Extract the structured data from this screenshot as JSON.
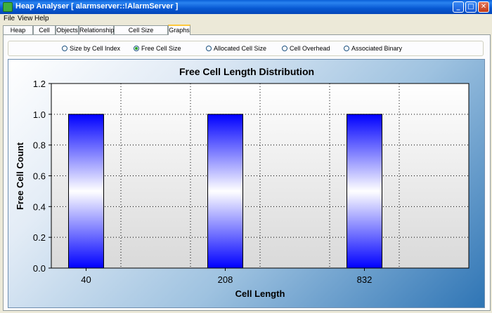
{
  "window": {
    "title": "Heap Analyser [ alarmserver::!AlarmServer ]",
    "controls": {
      "minimize": "_",
      "maximize": "□",
      "close": "✕"
    }
  },
  "menu": {
    "items": [
      "File",
      "View",
      "Help"
    ]
  },
  "tabs": [
    {
      "label": "Heap View",
      "active": false
    },
    {
      "label": "Cell List",
      "active": false
    },
    {
      "label": "Objects",
      "active": false
    },
    {
      "label": "Relationships",
      "active": false
    },
    {
      "label": "Cell Size Distributions",
      "active": false
    },
    {
      "label": "Graphs",
      "active": true
    }
  ],
  "graph_options": [
    {
      "label": "Size by Cell Index",
      "selected": false
    },
    {
      "label": "Free Cell Size",
      "selected": true
    },
    {
      "label": "Allocated Cell Size",
      "selected": false
    },
    {
      "label": "Cell Overhead",
      "selected": false
    },
    {
      "label": "Associated Binary",
      "selected": false
    }
  ],
  "chart_data": {
    "type": "bar",
    "title": "Free Cell Length Distribution",
    "xlabel": "Cell Length",
    "ylabel": "Free Cell Count",
    "categories": [
      "40",
      "208",
      "832"
    ],
    "values": [
      1.0,
      1.0,
      1.0
    ],
    "ylim": [
      0,
      1.2
    ],
    "yticks": [
      "0.0",
      "0.2",
      "0.4",
      "0.6",
      "0.8",
      "1.0",
      "1.2"
    ],
    "grid": true,
    "bar_colors": {
      "edge": "#0000ff",
      "center": "#ffffff"
    }
  }
}
